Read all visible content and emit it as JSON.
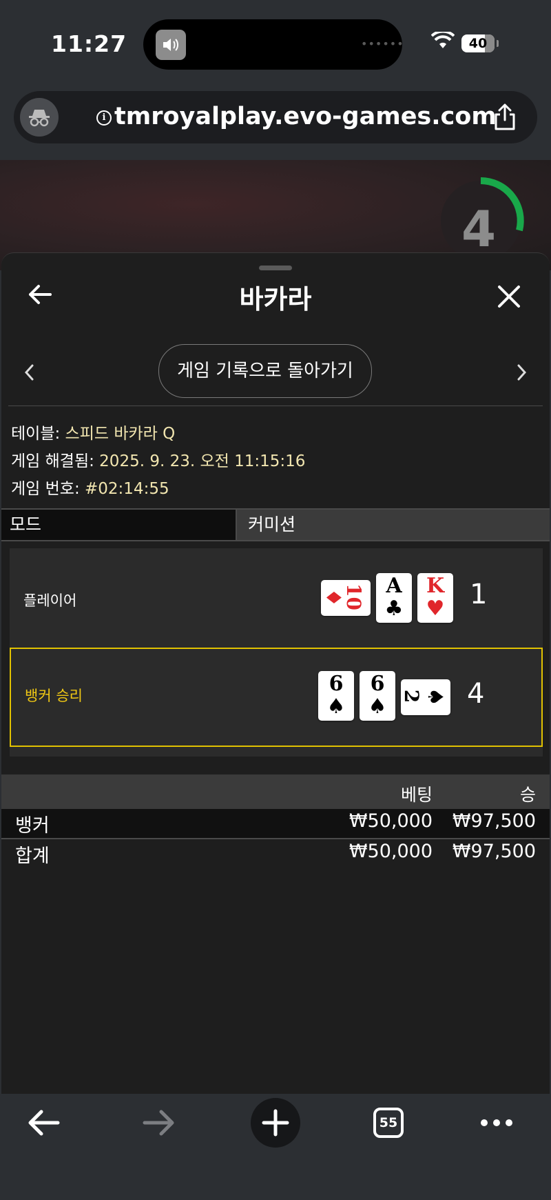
{
  "status_bar": {
    "time": "11:27",
    "battery": "40"
  },
  "browser": {
    "url": "tmroyalplay.evo-games.com",
    "tab_count": "55"
  },
  "video": {
    "countdown": "4"
  },
  "sheet": {
    "title": "바카라",
    "history_button": "게임 기록으로 돌아가기",
    "info": [
      {
        "label": "테이블: ",
        "value": "스피드 바카라 Q"
      },
      {
        "label": "게임 해결됨: ",
        "value": "2025. 9. 23. 오전 11:15:16"
      },
      {
        "label": "게임 번호: ",
        "value": "#02:14:55"
      }
    ],
    "mode_label": "모드",
    "commission_label": "커미션"
  },
  "hands": {
    "player": {
      "label": "플레이어",
      "score": "1",
      "cards": [
        {
          "rank": "10",
          "suit": "♦",
          "color": "#e0262b",
          "orientation": "horizontal"
        },
        {
          "rank": "A",
          "suit": "♣",
          "color": "#000000",
          "orientation": "vertical"
        },
        {
          "rank": "K",
          "suit": "♥",
          "color": "#e0262b",
          "orientation": "vertical"
        }
      ]
    },
    "banker": {
      "label": "뱅커 승리",
      "score": "4",
      "cards": [
        {
          "rank": "6",
          "suit": "♠",
          "color": "#000000",
          "orientation": "vertical"
        },
        {
          "rank": "6",
          "suit": "♠",
          "color": "#000000",
          "orientation": "vertical"
        },
        {
          "rank": "2",
          "suit": "♠",
          "color": "#000000",
          "orientation": "horizontal"
        }
      ]
    }
  },
  "bets_table": {
    "headers": {
      "bet": "베팅",
      "win": "승"
    },
    "rows": [
      {
        "name": "뱅커",
        "bet": "₩50,000",
        "win": "₩97,500"
      },
      {
        "name": "합계",
        "bet": "₩50,000",
        "win": "₩97,500"
      }
    ]
  },
  "colors": {
    "winner_highlight": "#e2c200",
    "info_value": "#f2e6b0",
    "timer_ring": "#19a84a"
  }
}
